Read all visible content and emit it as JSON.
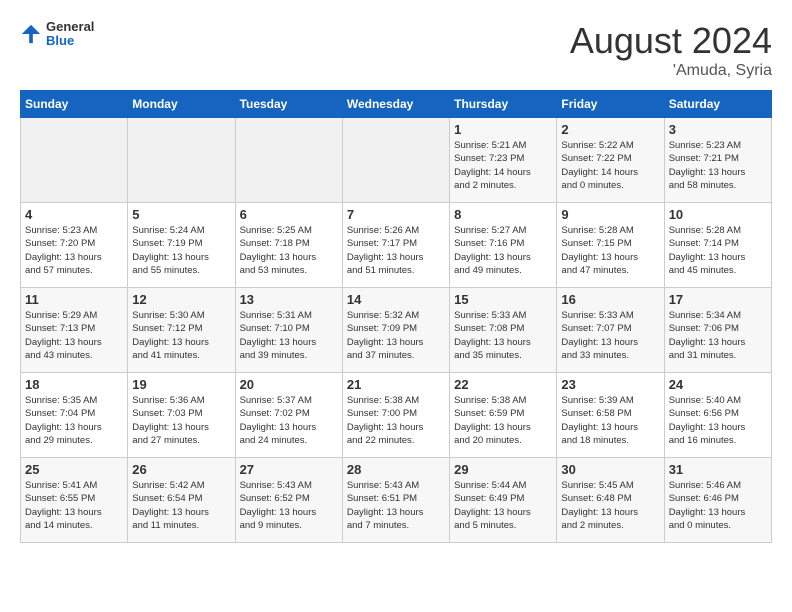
{
  "logo": {
    "general": "General",
    "blue": "Blue"
  },
  "title": "August 2024",
  "subtitle": "'Amuda, Syria",
  "days_header": [
    "Sunday",
    "Monday",
    "Tuesday",
    "Wednesday",
    "Thursday",
    "Friday",
    "Saturday"
  ],
  "weeks": [
    [
      {
        "day": "",
        "info": ""
      },
      {
        "day": "",
        "info": ""
      },
      {
        "day": "",
        "info": ""
      },
      {
        "day": "",
        "info": ""
      },
      {
        "day": "1",
        "info": "Sunrise: 5:21 AM\nSunset: 7:23 PM\nDaylight: 14 hours\nand 2 minutes."
      },
      {
        "day": "2",
        "info": "Sunrise: 5:22 AM\nSunset: 7:22 PM\nDaylight: 14 hours\nand 0 minutes."
      },
      {
        "day": "3",
        "info": "Sunrise: 5:23 AM\nSunset: 7:21 PM\nDaylight: 13 hours\nand 58 minutes."
      }
    ],
    [
      {
        "day": "4",
        "info": "Sunrise: 5:23 AM\nSunset: 7:20 PM\nDaylight: 13 hours\nand 57 minutes."
      },
      {
        "day": "5",
        "info": "Sunrise: 5:24 AM\nSunset: 7:19 PM\nDaylight: 13 hours\nand 55 minutes."
      },
      {
        "day": "6",
        "info": "Sunrise: 5:25 AM\nSunset: 7:18 PM\nDaylight: 13 hours\nand 53 minutes."
      },
      {
        "day": "7",
        "info": "Sunrise: 5:26 AM\nSunset: 7:17 PM\nDaylight: 13 hours\nand 51 minutes."
      },
      {
        "day": "8",
        "info": "Sunrise: 5:27 AM\nSunset: 7:16 PM\nDaylight: 13 hours\nand 49 minutes."
      },
      {
        "day": "9",
        "info": "Sunrise: 5:28 AM\nSunset: 7:15 PM\nDaylight: 13 hours\nand 47 minutes."
      },
      {
        "day": "10",
        "info": "Sunrise: 5:28 AM\nSunset: 7:14 PM\nDaylight: 13 hours\nand 45 minutes."
      }
    ],
    [
      {
        "day": "11",
        "info": "Sunrise: 5:29 AM\nSunset: 7:13 PM\nDaylight: 13 hours\nand 43 minutes."
      },
      {
        "day": "12",
        "info": "Sunrise: 5:30 AM\nSunset: 7:12 PM\nDaylight: 13 hours\nand 41 minutes."
      },
      {
        "day": "13",
        "info": "Sunrise: 5:31 AM\nSunset: 7:10 PM\nDaylight: 13 hours\nand 39 minutes."
      },
      {
        "day": "14",
        "info": "Sunrise: 5:32 AM\nSunset: 7:09 PM\nDaylight: 13 hours\nand 37 minutes."
      },
      {
        "day": "15",
        "info": "Sunrise: 5:33 AM\nSunset: 7:08 PM\nDaylight: 13 hours\nand 35 minutes."
      },
      {
        "day": "16",
        "info": "Sunrise: 5:33 AM\nSunset: 7:07 PM\nDaylight: 13 hours\nand 33 minutes."
      },
      {
        "day": "17",
        "info": "Sunrise: 5:34 AM\nSunset: 7:06 PM\nDaylight: 13 hours\nand 31 minutes."
      }
    ],
    [
      {
        "day": "18",
        "info": "Sunrise: 5:35 AM\nSunset: 7:04 PM\nDaylight: 13 hours\nand 29 minutes."
      },
      {
        "day": "19",
        "info": "Sunrise: 5:36 AM\nSunset: 7:03 PM\nDaylight: 13 hours\nand 27 minutes."
      },
      {
        "day": "20",
        "info": "Sunrise: 5:37 AM\nSunset: 7:02 PM\nDaylight: 13 hours\nand 24 minutes."
      },
      {
        "day": "21",
        "info": "Sunrise: 5:38 AM\nSunset: 7:00 PM\nDaylight: 13 hours\nand 22 minutes."
      },
      {
        "day": "22",
        "info": "Sunrise: 5:38 AM\nSunset: 6:59 PM\nDaylight: 13 hours\nand 20 minutes."
      },
      {
        "day": "23",
        "info": "Sunrise: 5:39 AM\nSunset: 6:58 PM\nDaylight: 13 hours\nand 18 minutes."
      },
      {
        "day": "24",
        "info": "Sunrise: 5:40 AM\nSunset: 6:56 PM\nDaylight: 13 hours\nand 16 minutes."
      }
    ],
    [
      {
        "day": "25",
        "info": "Sunrise: 5:41 AM\nSunset: 6:55 PM\nDaylight: 13 hours\nand 14 minutes."
      },
      {
        "day": "26",
        "info": "Sunrise: 5:42 AM\nSunset: 6:54 PM\nDaylight: 13 hours\nand 11 minutes."
      },
      {
        "day": "27",
        "info": "Sunrise: 5:43 AM\nSunset: 6:52 PM\nDaylight: 13 hours\nand 9 minutes."
      },
      {
        "day": "28",
        "info": "Sunrise: 5:43 AM\nSunset: 6:51 PM\nDaylight: 13 hours\nand 7 minutes."
      },
      {
        "day": "29",
        "info": "Sunrise: 5:44 AM\nSunset: 6:49 PM\nDaylight: 13 hours\nand 5 minutes."
      },
      {
        "day": "30",
        "info": "Sunrise: 5:45 AM\nSunset: 6:48 PM\nDaylight: 13 hours\nand 2 minutes."
      },
      {
        "day": "31",
        "info": "Sunrise: 5:46 AM\nSunset: 6:46 PM\nDaylight: 13 hours\nand 0 minutes."
      }
    ]
  ]
}
